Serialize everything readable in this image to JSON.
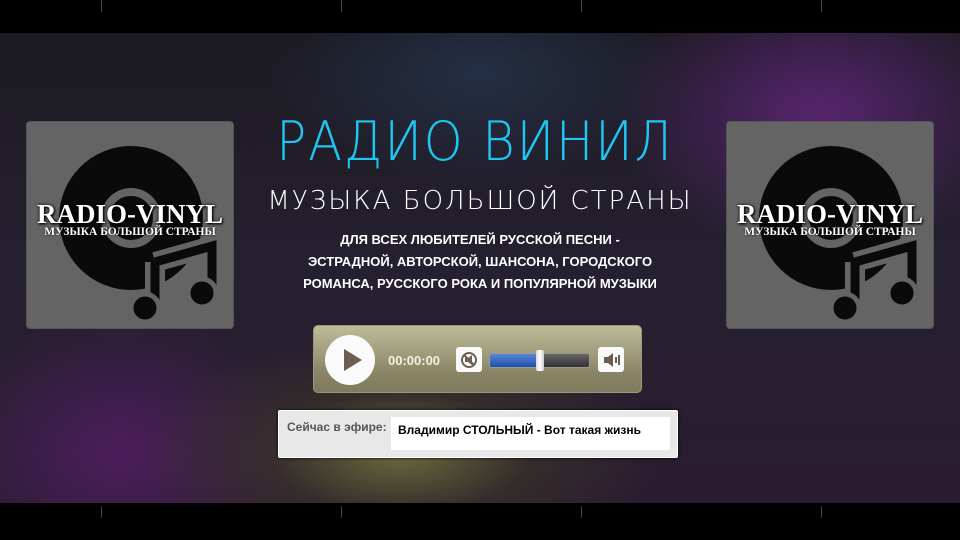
{
  "logo": {
    "brand": "RADIO-VINYL",
    "tagline": "МУЗЫКА БОЛЬШОЙ СТРАНЫ"
  },
  "header": {
    "title": "РАДИО ВИНИЛ",
    "subtitle": "МУЗЫКА БОЛЬШОЙ СТРАНЫ",
    "description": [
      "ДЛЯ ВСЕХ ЛЮБИТЕЛЕЙ РУССКОЙ ПЕСНИ -",
      "ЭСТРАДНОЙ, АВТОРСКОЙ, ШАНСОНА, ГОРОДСКОГО",
      "РОМАНСА, РУССКОГО РОКА И ПОПУЛЯРНОЙ МУЗЫКИ"
    ]
  },
  "player": {
    "time": "00:00:00",
    "volume_percent": 50,
    "accent": "#1fc6f2"
  },
  "now_playing": {
    "label": "Сейчас в эфире:",
    "track": "Владимир СТОЛЬНЫЙ - Вот такая жизнь"
  }
}
